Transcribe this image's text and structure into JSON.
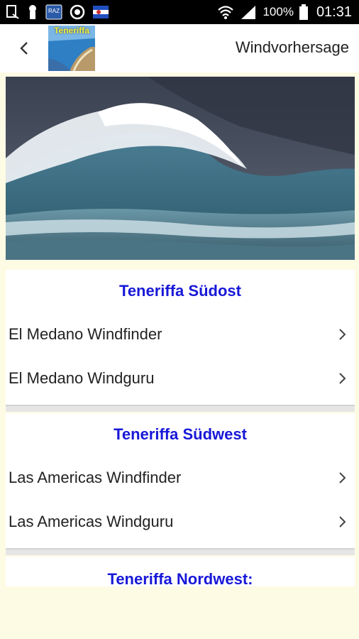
{
  "status_bar": {
    "battery_percent": "100%",
    "time": "01:31",
    "notification_badge": "RAZ"
  },
  "app_bar": {
    "logo_text": "Teneriffa",
    "title": "Windvorhersage"
  },
  "sections": [
    {
      "title": "Teneriffa Südost",
      "items": [
        "El Medano Windfinder",
        "El Medano Windguru"
      ]
    },
    {
      "title": "Teneriffa Südwest",
      "items": [
        "Las Americas Windfinder",
        "Las Americas Windguru"
      ]
    },
    {
      "title": "Teneriffa Nordwest:"
    }
  ],
  "colors": {
    "section_title": "#1818d8",
    "page_background": "#fdfbe4"
  }
}
